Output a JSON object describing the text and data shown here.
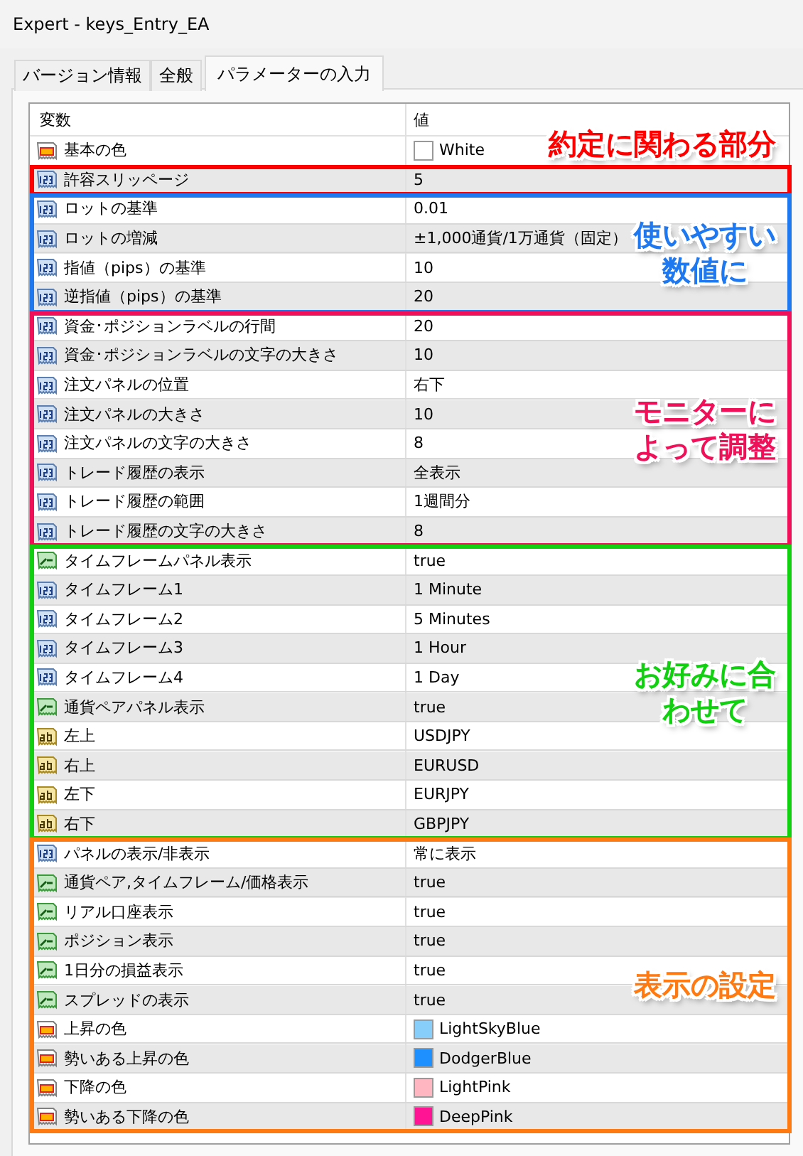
{
  "window": {
    "title": "Expert - keys_Entry_EA"
  },
  "tabs": [
    {
      "label": "バージョン情報",
      "selected": false
    },
    {
      "label": "全般",
      "selected": false
    },
    {
      "label": "パラメーターの入力",
      "selected": true
    }
  ],
  "table": {
    "columns": [
      "変数",
      "値"
    ],
    "sections": [
      {
        "rows": [
          {
            "kind": "color",
            "name": "基本の色",
            "value": "White",
            "color": "#ffffff"
          }
        ]
      },
      {
        "annotation": "約定に関わる部分",
        "color": "#ff0000",
        "rows": [
          {
            "kind": "number",
            "name": "許容スリッページ",
            "value": "5"
          }
        ]
      },
      {
        "annotation": "使いやすい数値に",
        "color": "#1e78f0",
        "rows": [
          {
            "kind": "number",
            "name": "ロットの基準",
            "value": "0.01"
          },
          {
            "kind": "number",
            "name": "ロットの増減",
            "value": "±1,000通貨/1万通貨（固定）"
          },
          {
            "kind": "number",
            "name": "指値（pips）の基準",
            "value": "10"
          },
          {
            "kind": "number",
            "name": "逆指値（pips）の基準",
            "value": "20"
          }
        ]
      },
      {
        "annotation": "モニターによって調整",
        "color": "#f0105a",
        "rows": [
          {
            "kind": "number",
            "name": "資金･ポジションラベルの行間",
            "value": "20"
          },
          {
            "kind": "number",
            "name": "資金･ポジションラベルの文字の大きさ",
            "value": "10"
          },
          {
            "kind": "number",
            "name": "注文パネルの位置",
            "value": "右下"
          },
          {
            "kind": "number",
            "name": "注文パネルの大きさ",
            "value": "10"
          },
          {
            "kind": "number",
            "name": "注文パネルの文字の大きさ",
            "value": "8"
          },
          {
            "kind": "number",
            "name": "トレード履歴の表示",
            "value": "全表示"
          },
          {
            "kind": "number",
            "name": "トレード履歴の範囲",
            "value": "1週間分"
          },
          {
            "kind": "number",
            "name": "トレード履歴の文字の大きさ",
            "value": "8"
          }
        ]
      },
      {
        "annotation": "お好みに合わせて",
        "color": "#10d010",
        "rows": [
          {
            "kind": "bool",
            "name": "タイムフレームパネル表示",
            "value": "true"
          },
          {
            "kind": "number",
            "name": "タイムフレーム1",
            "value": "1 Minute"
          },
          {
            "kind": "number",
            "name": "タイムフレーム2",
            "value": "5 Minutes"
          },
          {
            "kind": "number",
            "name": "タイムフレーム3",
            "value": "1 Hour"
          },
          {
            "kind": "number",
            "name": "タイムフレーム4",
            "value": "1 Day"
          },
          {
            "kind": "bool",
            "name": "通貨ペアパネル表示",
            "value": "true"
          },
          {
            "kind": "text",
            "name": "左上",
            "value": "USDJPY"
          },
          {
            "kind": "text",
            "name": "右上",
            "value": "EURUSD"
          },
          {
            "kind": "text",
            "name": "左下",
            "value": "EURJPY"
          },
          {
            "kind": "text",
            "name": "右下",
            "value": "GBPJPY"
          }
        ]
      },
      {
        "annotation": "表示の設定",
        "color": "#ff7a10",
        "rows": [
          {
            "kind": "number",
            "name": "パネルの表示/非表示",
            "value": "常に表示"
          },
          {
            "kind": "bool",
            "name": "通貨ペア,タイムフレーム/価格表示",
            "value": "true"
          },
          {
            "kind": "bool",
            "name": "リアル口座表示",
            "value": "true"
          },
          {
            "kind": "bool",
            "name": "ポジション表示",
            "value": "true"
          },
          {
            "kind": "bool",
            "name": "1日分の損益表示",
            "value": "true"
          },
          {
            "kind": "bool",
            "name": "スプレッドの表示",
            "value": "true"
          },
          {
            "kind": "color",
            "name": "上昇の色",
            "value": "LightSkyBlue",
            "color": "#87cefa"
          },
          {
            "kind": "color",
            "name": "勢いある上昇の色",
            "value": "DodgerBlue",
            "color": "#1e90ff"
          },
          {
            "kind": "color",
            "name": "下降の色",
            "value": "LightPink",
            "color": "#ffb6c1"
          },
          {
            "kind": "color",
            "name": "勢いある下降の色",
            "value": "DeepPink",
            "color": "#ff1493"
          }
        ]
      }
    ]
  }
}
